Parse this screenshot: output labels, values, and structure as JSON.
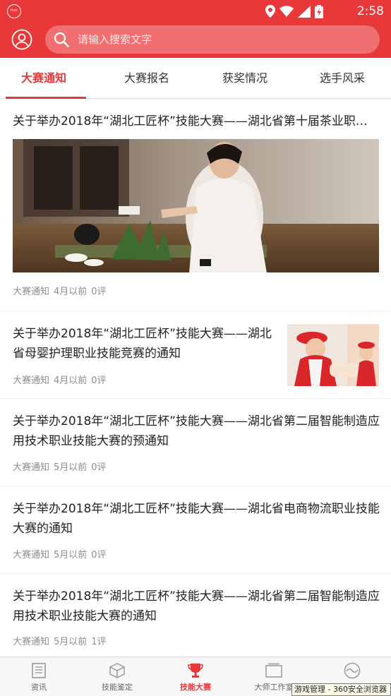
{
  "status_bar": {
    "time": "2:58",
    "app_badge": "fcoc"
  },
  "header": {
    "search_placeholder": "请输入搜索文字"
  },
  "tabs": [
    {
      "label": "大赛通知",
      "active": true
    },
    {
      "label": "大赛报名",
      "active": false
    },
    {
      "label": "获奖情况",
      "active": false
    },
    {
      "label": "选手风采",
      "active": false
    }
  ],
  "news": [
    {
      "title": "关于举办2018年“湖北工匠杯”技能大赛——湖北省第十届茶业职…",
      "category": "大赛通知",
      "time": "4月以前",
      "comments": "0评"
    },
    {
      "title": "关于举办2018年“湖北工匠杯”技能大赛——湖北省母婴护理职业技能竞赛的通知",
      "category": "大赛通知",
      "time": "4月以前",
      "comments": "0评"
    },
    {
      "title": "关于举办2018年“湖北工匠杯”技能大赛——湖北省第二届智能制造应用技术职业技能大赛的预通知",
      "category": "大赛通知",
      "time": "5月以前",
      "comments": "0评"
    },
    {
      "title": "关于举办2018年“湖北工匠杯”技能大赛——湖北省电商物流职业技能大赛的通知",
      "category": "大赛通知",
      "time": "5月以前",
      "comments": "0评"
    },
    {
      "title": "关于举办2018年“湖北工匠杯”技能大赛——湖北省第二届智能制造应用技术职业技能大赛的通知",
      "category": "大赛通知",
      "time": "5月以前",
      "comments": "1评"
    }
  ],
  "bottom_nav": [
    {
      "label": "资讯",
      "icon": "document-icon",
      "active": false
    },
    {
      "label": "技能鉴定",
      "icon": "cube-icon",
      "active": false
    },
    {
      "label": "技能大赛",
      "icon": "trophy-icon",
      "active": true
    },
    {
      "label": "大师工作室",
      "icon": "folder-icon",
      "active": false
    },
    {
      "label": "",
      "icon": "wave-circle-icon",
      "active": false
    }
  ],
  "tooltip": "游戏管理 - 360安全浏览器",
  "colors": {
    "brand_red": "#e8383a",
    "search_bg": "#f07072",
    "meta_gray": "#8c8c8c"
  }
}
